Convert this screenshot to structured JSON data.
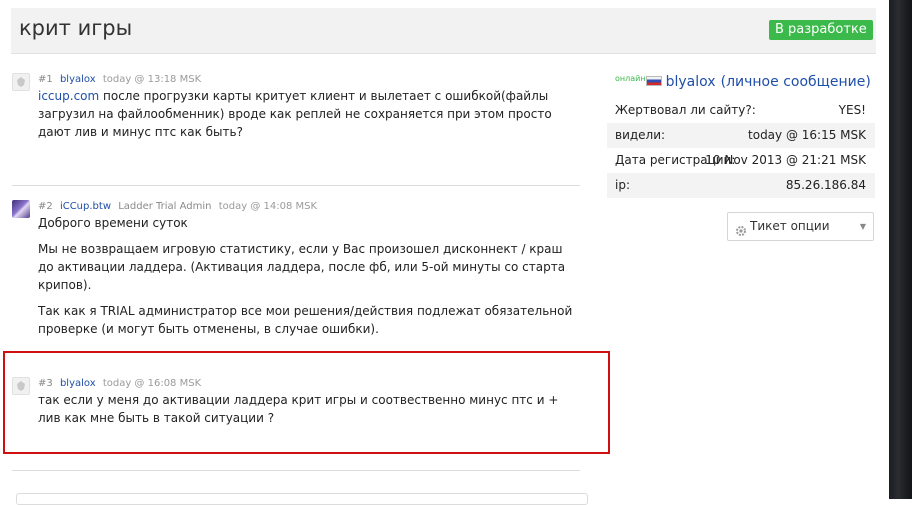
{
  "header": {
    "title": "крит игры",
    "status": "В разработке",
    "status_color": "#3cb94b"
  },
  "posts": [
    {
      "num": "#1",
      "user": "blyalox",
      "role": "",
      "time": "today @ 13:18 MSK",
      "link": "iccup.com",
      "paragraphs": [
        " после прогрузки карты критует клиент и вылетает с ошибкой(файлы загрузил на файлообменник) вроде как реплей не сохраняется при этом просто дают лив и минус птс как быть?"
      ]
    },
    {
      "num": "#2",
      "user": "iCCup.btw",
      "role": "Ladder Trial Admin",
      "time": "today @ 14:08 MSK",
      "paragraphs": [
        "Доброго времени суток",
        "Мы не возвращаем игровую статистику, если у Вас произошел дисконнект / краш до активации ладдера. (Активация ладдера, после фб, или 5-ой минуты со старта крипов).",
        "Так как я TRIAL администратор все мои решения/действия подлежат обязательной проверке (и могут быть отменены, в случае ошибки)."
      ]
    },
    {
      "num": "#3",
      "user": "blyalox",
      "role": "",
      "time": "today @ 16:08 MSK",
      "paragraphs": [
        "так если у меня до активации ладдера крит игры и соотвественно минус птс и + лив как мне быть в такой ситуации ?"
      ]
    }
  ],
  "sidebar": {
    "online_label": "онлайн",
    "username": "blyalox",
    "pm_label": "(личное сообщение)",
    "rows": [
      {
        "label": "Жертвовал ли сайту?:",
        "value": "YES!"
      },
      {
        "label": "видели:",
        "value": "today @ 16:15 MSK"
      },
      {
        "label": "Дата регистрации:",
        "value": "10 Nov 2013 @ 21:21 MSK"
      },
      {
        "label": "ip:",
        "value": "85.26.186.84"
      }
    ],
    "ticket_options_label": "Тикет опции"
  }
}
